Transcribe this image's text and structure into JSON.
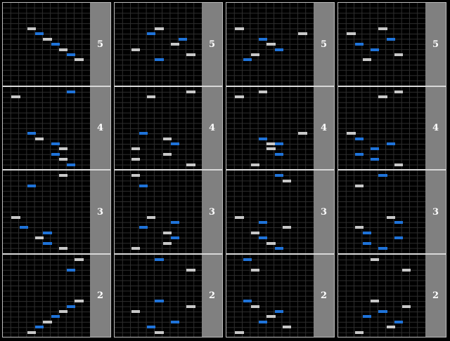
{
  "chart_type": "step-sequence chart",
  "colors": {
    "background": "#000000",
    "grid_line": "#2e2e2e",
    "white_note": "#c8c8c8",
    "blue_note": "#1f73d9",
    "side_bar": "#808080",
    "separator": "#d9d9d9"
  },
  "lanes": 7,
  "rows_per_measure": 16,
  "columns": [
    {
      "measures": [
        {
          "label": "5",
          "notes": [
            [
              4,
              5,
              "white"
            ],
            [
              5,
              6,
              "blue"
            ],
            [
              6,
              7,
              "white"
            ],
            [
              7,
              8,
              "blue"
            ],
            [
              8,
              9,
              "white"
            ],
            [
              9,
              10,
              "blue"
            ],
            [
              10,
              11,
              "white"
            ]
          ]
        },
        {
          "label": "4",
          "notes": [
            [
              9,
              1,
              "blue"
            ],
            [
              2,
              2,
              "white"
            ],
            [
              4,
              9,
              "blue"
            ],
            [
              5,
              10,
              "white"
            ],
            [
              7,
              11,
              "blue"
            ],
            [
              8,
              12,
              "white"
            ],
            [
              7,
              13,
              "blue"
            ],
            [
              8,
              14,
              "white"
            ],
            [
              9,
              15,
              "blue"
            ]
          ]
        },
        {
          "label": "3",
          "notes": [
            [
              8,
              1,
              "white"
            ],
            [
              4,
              3,
              "blue"
            ],
            [
              2,
              9,
              "white"
            ],
            [
              3,
              11,
              "blue"
            ],
            [
              6,
              12,
              "blue"
            ],
            [
              5,
              13,
              "white"
            ],
            [
              6,
              14,
              "blue"
            ],
            [
              8,
              15,
              "white"
            ]
          ]
        },
        {
          "label": "2",
          "notes": [
            [
              10,
              1,
              "white"
            ],
            [
              9,
              3,
              "blue"
            ],
            [
              10,
              9,
              "white"
            ],
            [
              9,
              10,
              "blue"
            ],
            [
              8,
              11,
              "white"
            ],
            [
              7,
              12,
              "blue"
            ],
            [
              6,
              13,
              "white"
            ],
            [
              5,
              14,
              "blue"
            ],
            [
              4,
              15,
              "white"
            ]
          ]
        }
      ]
    },
    {
      "measures": [
        {
          "label": "5",
          "notes": [
            [
              6,
              5,
              "white"
            ],
            [
              5,
              6,
              "blue"
            ],
            [
              9,
              7,
              "blue"
            ],
            [
              8,
              8,
              "white"
            ],
            [
              3,
              9,
              "white"
            ],
            [
              10,
              10,
              "white"
            ],
            [
              6,
              11,
              "blue"
            ]
          ]
        },
        {
          "label": "4",
          "notes": [
            [
              10,
              1,
              "white"
            ],
            [
              5,
              2,
              "white"
            ],
            [
              4,
              9,
              "blue"
            ],
            [
              7,
              10,
              "white"
            ],
            [
              8,
              11,
              "blue"
            ],
            [
              3,
              12,
              "white"
            ],
            [
              7,
              13,
              "white"
            ],
            [
              3,
              14,
              "white"
            ],
            [
              10,
              15,
              "white"
            ]
          ]
        },
        {
          "label": "3",
          "notes": [
            [
              3,
              1,
              "white"
            ],
            [
              4,
              3,
              "blue"
            ],
            [
              5,
              9,
              "white"
            ],
            [
              8,
              10,
              "blue"
            ],
            [
              4,
              11,
              "blue"
            ],
            [
              7,
              12,
              "white"
            ],
            [
              8,
              13,
              "blue"
            ],
            [
              7,
              14,
              "white"
            ],
            [
              3,
              15,
              "white"
            ]
          ]
        },
        {
          "label": "2",
          "notes": [
            [
              6,
              1,
              "blue"
            ],
            [
              10,
              3,
              "white"
            ],
            [
              6,
              9,
              "blue"
            ],
            [
              10,
              10,
              "white"
            ],
            [
              3,
              11,
              "white"
            ],
            [
              8,
              13,
              "blue"
            ],
            [
              5,
              14,
              "blue"
            ],
            [
              6,
              15,
              "white"
            ]
          ]
        }
      ]
    },
    {
      "measures": [
        {
          "label": "5",
          "notes": [
            [
              2,
              5,
              "white"
            ],
            [
              10,
              6,
              "white"
            ],
            [
              5,
              7,
              "blue"
            ],
            [
              6,
              8,
              "white"
            ],
            [
              7,
              9,
              "blue"
            ],
            [
              4,
              10,
              "white"
            ],
            [
              3,
              11,
              "blue"
            ]
          ]
        },
        {
          "label": "4",
          "notes": [
            [
              5,
              1,
              "white"
            ],
            [
              2,
              2,
              "white"
            ],
            [
              10,
              9,
              "white"
            ],
            [
              5,
              10,
              "blue"
            ],
            [
              6,
              11,
              "white"
            ],
            [
              7,
              11,
              "blue"
            ],
            [
              6,
              12,
              "white"
            ],
            [
              7,
              13,
              "blue"
            ],
            [
              4,
              15,
              "white"
            ]
          ]
        },
        {
          "label": "3",
          "notes": [
            [
              7,
              1,
              "blue"
            ],
            [
              8,
              2,
              "white"
            ],
            [
              2,
              9,
              "white"
            ],
            [
              5,
              10,
              "blue"
            ],
            [
              8,
              11,
              "white"
            ],
            [
              4,
              12,
              "white"
            ],
            [
              5,
              13,
              "blue"
            ],
            [
              6,
              14,
              "white"
            ],
            [
              7,
              15,
              "blue"
            ]
          ]
        },
        {
          "label": "2",
          "notes": [
            [
              3,
              1,
              "blue"
            ],
            [
              4,
              3,
              "white"
            ],
            [
              3,
              9,
              "blue"
            ],
            [
              4,
              10,
              "white"
            ],
            [
              7,
              11,
              "blue"
            ],
            [
              6,
              12,
              "white"
            ],
            [
              5,
              13,
              "blue"
            ],
            [
              8,
              14,
              "white"
            ],
            [
              2,
              15,
              "white"
            ]
          ]
        }
      ]
    },
    {
      "measures": [
        {
          "label": "5",
          "notes": [
            [
              6,
              5,
              "white"
            ],
            [
              2,
              6,
              "white"
            ],
            [
              7,
              7,
              "blue"
            ],
            [
              3,
              8,
              "blue"
            ],
            [
              5,
              9,
              "blue"
            ],
            [
              8,
              10,
              "white"
            ],
            [
              4,
              11,
              "white"
            ]
          ]
        },
        {
          "label": "4",
          "notes": [
            [
              8,
              1,
              "white"
            ],
            [
              6,
              2,
              "white"
            ],
            [
              2,
              9,
              "white"
            ],
            [
              3,
              10,
              "blue"
            ],
            [
              7,
              11,
              "blue"
            ],
            [
              5,
              12,
              "blue"
            ],
            [
              3,
              13,
              "blue"
            ],
            [
              5,
              14,
              "blue"
            ],
            [
              8,
              15,
              "white"
            ]
          ]
        },
        {
          "label": "3",
          "notes": [
            [
              6,
              1,
              "blue"
            ],
            [
              3,
              3,
              "white"
            ],
            [
              7,
              9,
              "white"
            ],
            [
              8,
              10,
              "blue"
            ],
            [
              3,
              11,
              "white"
            ],
            [
              4,
              12,
              "blue"
            ],
            [
              8,
              13,
              "blue"
            ],
            [
              4,
              14,
              "blue"
            ],
            [
              6,
              15,
              "blue"
            ]
          ]
        },
        {
          "label": "2",
          "notes": [
            [
              5,
              1,
              "white"
            ],
            [
              9,
              3,
              "white"
            ],
            [
              5,
              9,
              "white"
            ],
            [
              9,
              10,
              "white"
            ],
            [
              6,
              11,
              "blue"
            ],
            [
              4,
              12,
              "blue"
            ],
            [
              8,
              13,
              "blue"
            ],
            [
              7,
              14,
              "white"
            ],
            [
              3,
              15,
              "white"
            ]
          ]
        }
      ]
    }
  ]
}
